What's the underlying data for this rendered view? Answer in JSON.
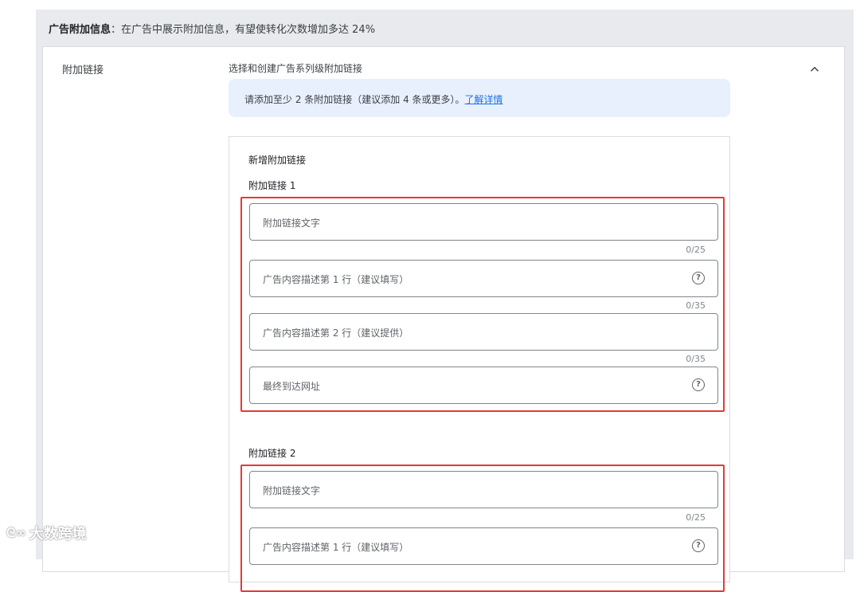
{
  "banner": {
    "bold": "广告附加信息",
    "text": "：在广告中展示附加信息，有望使转化次数增加多达 24%"
  },
  "section": {
    "label": "附加链接",
    "subtitle": "选择和创建广告系列级附加链接",
    "collapse_icon": "chevron-up-icon"
  },
  "info": {
    "text": "请添加至少 2 条附加链接（建议添加 4 条或更多）。",
    "link": "了解详情"
  },
  "panel": {
    "title": "新增附加链接",
    "groups": [
      {
        "label": "附加链接 1",
        "fields": [
          {
            "placeholder": "附加链接文字",
            "counter": "0/25",
            "help": false
          },
          {
            "placeholder": "广告内容描述第 1 行（建议填写）",
            "counter": "0/35",
            "help": true
          },
          {
            "placeholder": "广告内容描述第 2 行（建议提供）",
            "counter": "0/35",
            "help": false
          },
          {
            "placeholder": "最终到达网址",
            "counter": "",
            "help": true
          }
        ]
      },
      {
        "label": "附加链接 2",
        "fields": [
          {
            "placeholder": "附加链接文字",
            "counter": "0/25",
            "help": false
          },
          {
            "placeholder": "广告内容描述第 1 行（建议填写）",
            "counter": "",
            "help": true
          }
        ]
      }
    ],
    "help_glyph": "?"
  },
  "watermark": {
    "logo": "ᘓ∞",
    "text": "大数跨境"
  }
}
